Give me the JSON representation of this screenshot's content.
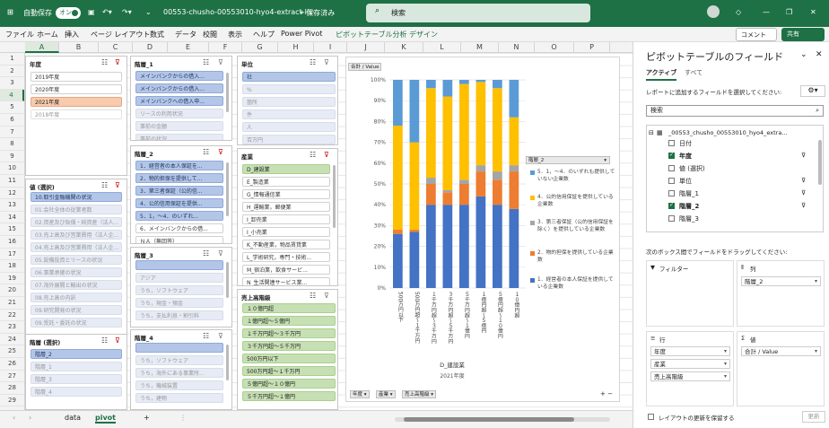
{
  "titlebar": {
    "autosave": "自動保存",
    "toggle": "オン",
    "filename": "00553-chusho-00553010-hyo4-extract-lis···",
    "saved": "• 保存済み",
    "search": "検索"
  },
  "menu": {
    "items": [
      "ファイル",
      "ホーム",
      "挿入",
      "ページ レイアウト",
      "数式",
      "データ",
      "校閲",
      "表示",
      "ヘルプ",
      "Power Pivot",
      "ピボットテーブル分析",
      "デザイン"
    ],
    "comment": "コメント",
    "share": "共有"
  },
  "columns": [
    "A",
    "B",
    "C",
    "D",
    "E",
    "F",
    "G",
    "H",
    "I",
    "J",
    "K",
    "L",
    "M",
    "N",
    "O",
    "P"
  ],
  "rows": [
    "1",
    "2",
    "3",
    "4",
    "5",
    "6",
    "7",
    "8",
    "9",
    "10",
    "11",
    "12",
    "13",
    "14",
    "15",
    "16",
    "17",
    "18",
    "19",
    "20",
    "21",
    "22",
    "23",
    "24",
    "25",
    "26",
    "27",
    "28",
    "29"
  ],
  "slicers": {
    "nendo": {
      "title": "年度",
      "items": [
        "2019年度",
        "2020年度",
        "2021年度",
        "2018年度"
      ]
    },
    "atai": {
      "title": "値 (選択)",
      "items": [
        "10.取引金融機関の状況",
        "01.会社全体の従業者数",
        "02.資産及び負債・純資産（法人...",
        "03.売上高及び営業費用（法人企...",
        "04.売上高及び営業費用（法人企...",
        "05.設備投資とリースの状況",
        "06.事業承継の状況",
        "07.海外展開と輸出の状況",
        "08.売上高の内訳",
        "09.研究開発の状況",
        "09.受託・委託の状況"
      ]
    },
    "kaiso_sel": {
      "title": "階層 (選択)",
      "items": [
        "階層_2",
        "階層_1",
        "階層_3",
        "階層_4"
      ]
    },
    "kaiso1": {
      "title": "階層_1",
      "items": [
        "メインバンクからの借入...",
        "メインバンクからの借入...",
        "メインバンクへの借入申...",
        "リースの利用状況",
        "事前の金額",
        "事前の状況"
      ]
    },
    "kaiso2": {
      "title": "階層_2",
      "items": [
        "1．経営者の本人保証を...",
        "2．物的担保を提供して...",
        "3．第三者保証（公的信...",
        "4．公的信用保証を提供...",
        "5．1，～4．のいずれ...",
        "6．メインバンクからの借...",
        "ＮＡ（無回答）"
      ]
    },
    "kaiso3": {
      "title": "階層_3",
      "items": [
        "",
        "アジア",
        "うち，ソフトウェア",
        "うち，現金・預金",
        "うち，支払利息・割引料"
      ]
    },
    "kaiso4": {
      "title": "階層_4",
      "items": [
        "",
        "うち，ソフトウェア",
        "うち，海外にある事業所...",
        "うち，機械装置",
        "うち，建物"
      ]
    },
    "tani": {
      "title": "単位",
      "items": [
        "社",
        "%",
        "箇所",
        "件",
        "人",
        "百万円"
      ]
    },
    "sangyo": {
      "title": "産業",
      "items": [
        "D_建設業",
        "E_製造業",
        "G_情報通信業",
        "H_運輸業，郵便業",
        "I_卸売業",
        "I_小売業",
        "K_不動産業，物品賃貸業",
        "L_学術研究，専門・技術...",
        "M_宿泊業，飲食サービ...",
        "N_生活関連サービス業..."
      ]
    },
    "uriage": {
      "title": "売上高階級",
      "items": [
        "１０億円超",
        "１億円超～５億円",
        "１千万円超～３千万円",
        "３千万円超～５千万円",
        "500万円以下",
        "500万円超～１千万円",
        "５億円超～１０億円",
        "５千万円超～１億円"
      ]
    }
  },
  "chart_data": {
    "type": "bar",
    "stacked": true,
    "value_label": "合計 / Value",
    "x_title": "D_建設業",
    "x_subtitle": "2021年度",
    "categories": [
      "500万円以下",
      "500万円超～１千万円",
      "１千万円超～３千万円",
      "３千万円超～５千万円",
      "５千万円超～１億円",
      "１億円超～５億円",
      "５億円超～１０億円",
      "１０億円超"
    ],
    "ylim": [
      0,
      100
    ],
    "yticks": [
      "0%",
      "10%",
      "20%",
      "30%",
      "40%",
      "50%",
      "60%",
      "70%",
      "80%",
      "90%",
      "100%"
    ],
    "series": [
      {
        "name": "1．経営者の本人保証を提供している企業数",
        "color": "#4472c4",
        "values": [
          26,
          27,
          40,
          40,
          40,
          44,
          40,
          38
        ]
      },
      {
        "name": "2．物的担保を提供している企業数",
        "color": "#ed7d31",
        "values": [
          2,
          1,
          10,
          6,
          10,
          12,
          12,
          18
        ]
      },
      {
        "name": "3．第三者保証（公的信用保証を除く）を提供している企業数",
        "color": "#a5a5a5",
        "values": [
          0,
          0,
          3,
          1,
          2,
          3,
          4,
          3
        ]
      },
      {
        "name": "4．公的信用保証を提供している企業数",
        "color": "#ffc000",
        "values": [
          50,
          42,
          43,
          45,
          46,
          40,
          40,
          23
        ]
      },
      {
        "name": "5．1，～4．のいずれも提供していない企業数",
        "color": "#5b9bd5",
        "values": [
          22,
          30,
          4,
          8,
          2,
          1,
          4,
          18
        ]
      }
    ],
    "legend_title": "階層_2",
    "bottom_pills": [
      "年度",
      "産業",
      "売上高階級"
    ]
  },
  "pane": {
    "title": "ピボットテーブルのフィールド",
    "tab_active": "アクティブ",
    "tab_all": "すべて",
    "prompt": "レポートに追加するフィールドを選択してください:",
    "search": "検索",
    "table": "_00553_chusho_00553010_hyo4_extra...",
    "fields": [
      {
        "label": "日付",
        "on": false
      },
      {
        "label": "年度",
        "on": true
      },
      {
        "label": "値 (選択)",
        "on": false
      },
      {
        "label": "単位",
        "on": false
      },
      {
        "label": "階層_1",
        "on": false
      },
      {
        "label": "階層_2",
        "on": true
      },
      {
        "label": "階層_3",
        "on": false
      }
    ],
    "drag": "次のボックス間でフィールドをドラッグしてください:",
    "filter": "フィルター",
    "col": "列",
    "row": "行",
    "value": "値",
    "col_items": [
      "階層_2"
    ],
    "row_items": [
      "年度",
      "産業",
      "売上高階級"
    ],
    "value_items": [
      "合計 / Value"
    ],
    "defer": "レイアウトの更新を保留する",
    "update": "更新"
  },
  "tabs": [
    "data",
    "pivot"
  ]
}
